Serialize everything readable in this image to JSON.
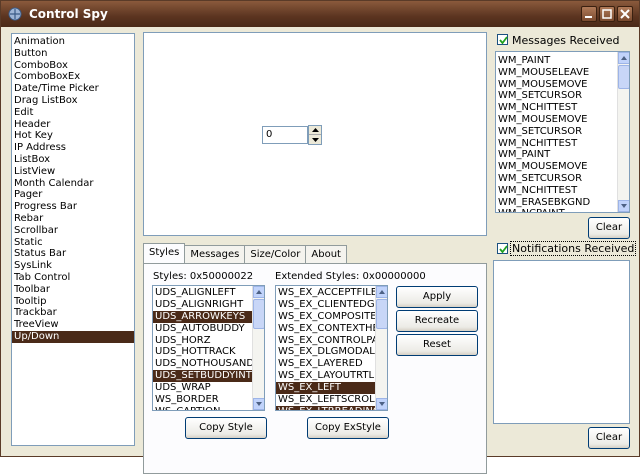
{
  "window": {
    "title": "Control Spy"
  },
  "controls": [
    "Animation",
    "Button",
    "ComboBox",
    "ComboBoxEx",
    "Date/Time Picker",
    "Drag ListBox",
    "Edit",
    "Header",
    "Hot Key",
    "IP Address",
    "ListBox",
    "ListView",
    "Month Calendar",
    "Pager",
    "Progress Bar",
    "Rebar",
    "Scrollbar",
    "Static",
    "Status Bar",
    "SysLink",
    "Tab Control",
    "Toolbar",
    "Tooltip",
    "Trackbar",
    "TreeView",
    "Up/Down"
  ],
  "selected_control": "Up/Down",
  "preview": {
    "updown_value": "0"
  },
  "tabs": [
    "Styles",
    "Messages",
    "Size/Color",
    "About"
  ],
  "styles": {
    "label": "Styles: 0x50000022",
    "items": [
      "UDS_ALIGNLEFT",
      "UDS_ALIGNRIGHT",
      "UDS_ARROWKEYS",
      "UDS_AUTOBUDDY",
      "UDS_HORZ",
      "UDS_HOTTRACK",
      "UDS_NOTHOUSANDS",
      "UDS_SETBUDDYINT",
      "UDS_WRAP",
      "WS_BORDER",
      "WS_CAPTION"
    ],
    "selected": [
      "UDS_ARROWKEYS",
      "UDS_SETBUDDYINT"
    ]
  },
  "ex_styles": {
    "label": "Extended Styles: 0x00000000",
    "items": [
      "WS_EX_ACCEPTFILES",
      "WS_EX_CLIENTEDGE",
      "WS_EX_COMPOSITED",
      "WS_EX_CONTEXTHELP",
      "WS_EX_CONTROLPARENT",
      "WS_EX_DLGMODALFRAME",
      "WS_EX_LAYERED",
      "WS_EX_LAYOUTRTL",
      "WS_EX_LEFT",
      "WS_EX_LEFTSCROLLBAR",
      "WS_EX_LTRREADING"
    ],
    "selected": [
      "WS_EX_LEFT",
      "WS_EX_LTRREADING"
    ]
  },
  "buttons": {
    "apply": "Apply",
    "recreate": "Recreate",
    "reset": "Reset",
    "copy_style": "Copy Style",
    "copy_exstyle": "Copy ExStyle",
    "clear_messages": "Clear",
    "clear_notifications": "Clear"
  },
  "messages": {
    "label": "Messages Received",
    "checked": true,
    "items": [
      "WM_PAINT",
      "WM_MOUSELEAVE",
      "WM_MOUSEMOVE",
      "WM_SETCURSOR",
      "WM_NCHITTEST",
      "WM_MOUSEMOVE",
      "WM_SETCURSOR",
      "WM_NCHITTEST",
      "WM_PAINT",
      "WM_MOUSEMOVE",
      "WM_SETCURSOR",
      "WM_NCHITTEST",
      "WM_ERASEBKGND",
      "WM_NCPAINT"
    ]
  },
  "notifications": {
    "label": "Notifications Received",
    "checked": true,
    "items": []
  }
}
